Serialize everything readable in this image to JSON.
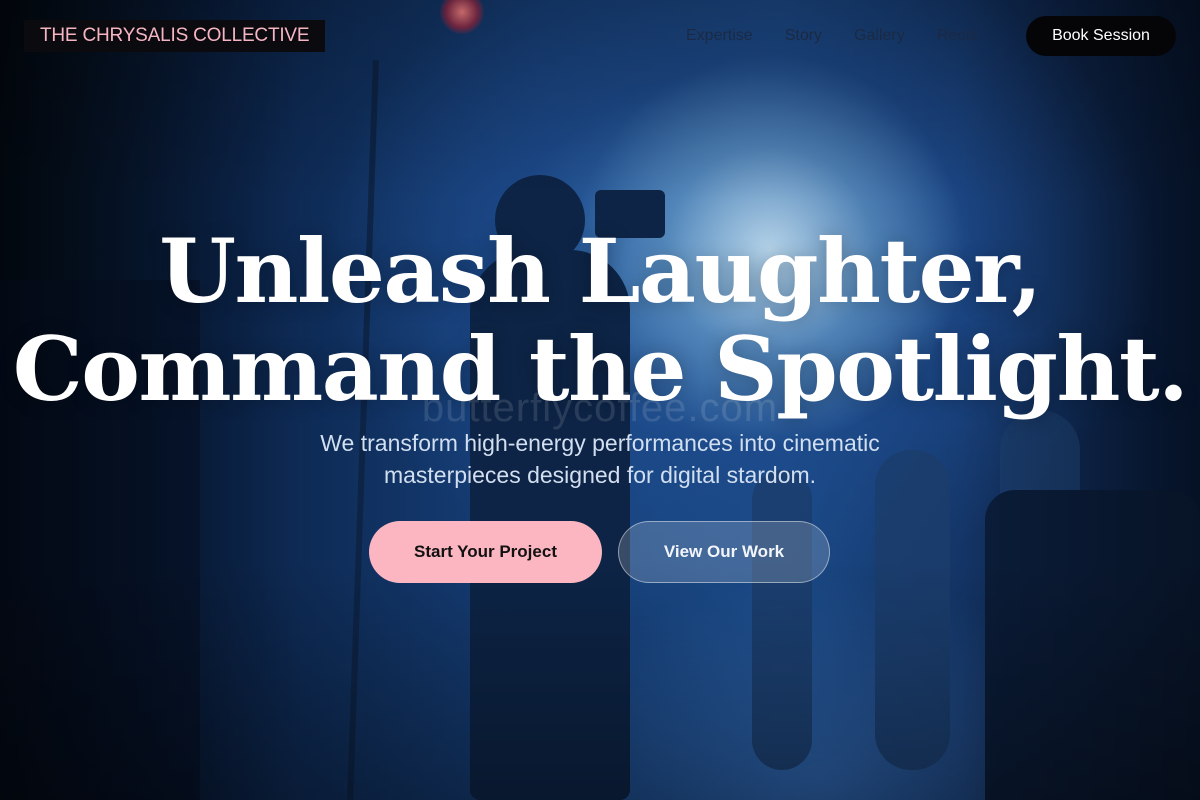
{
  "brand": {
    "name": "THE CHRYSALIS COLLECTIVE",
    "accent": "#f6b5c2"
  },
  "nav": {
    "items": [
      "Expertise",
      "Story",
      "Gallery",
      "Reels"
    ],
    "cta_label": "Book Session"
  },
  "hero": {
    "headline_line1": "Unleash Laughter,",
    "headline_line2": "Command the Spotlight.",
    "watermark": "butterflycoffee.com",
    "subtitle": "We transform high-energy performances into cinematic masterpieces designed for digital stardom.",
    "primary_cta": "Start Your Project",
    "secondary_cta": "View Our Work",
    "primary_cta_color": "#fbb6c1"
  }
}
